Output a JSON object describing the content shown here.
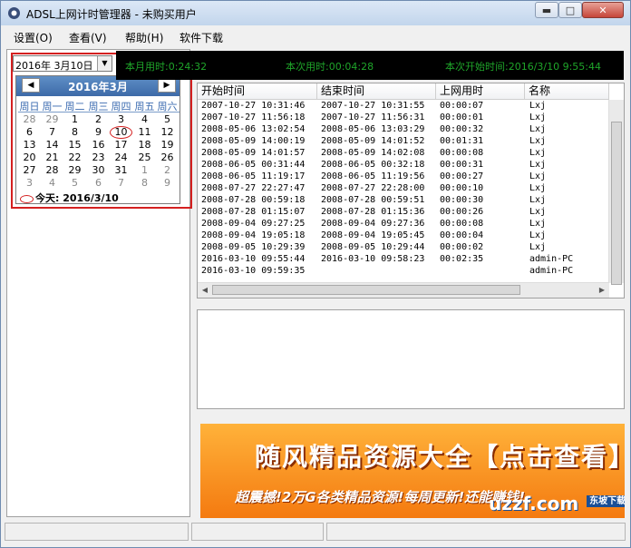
{
  "window": {
    "title": "ADSL上网计时管理器 - 未购买用户",
    "min_symbol": "▬",
    "max_symbol": "□",
    "close_symbol": "✕"
  },
  "menu": {
    "items": [
      "设置(O)",
      "查看(V)",
      "帮助(H)",
      "软件下载"
    ]
  },
  "date_picker": {
    "value": "2016年  3月10日"
  },
  "calendar": {
    "month_title": "2016年3月",
    "weekdays": [
      "周日",
      "周一",
      "周二",
      "周三",
      "周四",
      "周五",
      "周六"
    ],
    "days": [
      [
        "28",
        "29",
        "1",
        "2",
        "3",
        "4",
        "5"
      ],
      [
        "6",
        "7",
        "8",
        "9",
        "10",
        "11",
        "12"
      ],
      [
        "13",
        "14",
        "15",
        "16",
        "17",
        "18",
        "19"
      ],
      [
        "20",
        "21",
        "22",
        "23",
        "24",
        "25",
        "26"
      ],
      [
        "27",
        "28",
        "29",
        "30",
        "31",
        "1",
        "2"
      ],
      [
        "3",
        "4",
        "5",
        "6",
        "7",
        "8",
        "9"
      ]
    ],
    "selected_day": "10",
    "today_text": "今天: 2016/3/10"
  },
  "status": {
    "month_usage": "本月用时:0:24:32",
    "current_usage": "本次用时:00:04:28",
    "current_start": "本次开始时间:2016/3/10 9:55:44"
  },
  "table": {
    "headers": [
      "开始时间",
      "结束时间",
      "上网用时",
      "名称"
    ],
    "rows": [
      [
        "2007-10-27 10:31:46",
        "2007-10-27 10:31:55",
        "00:00:07",
        "Lxj"
      ],
      [
        "2007-10-27 11:56:18",
        "2007-10-27 11:56:31",
        "00:00:01",
        "Lxj"
      ],
      [
        "2008-05-06 13:02:54",
        "2008-05-06 13:03:29",
        "00:00:32",
        "Lxj"
      ],
      [
        "2008-05-09 14:00:19",
        "2008-05-09 14:01:52",
        "00:01:31",
        "Lxj"
      ],
      [
        "2008-05-09 14:01:57",
        "2008-05-09 14:02:08",
        "00:00:08",
        "Lxj"
      ],
      [
        "2008-06-05 00:31:44",
        "2008-06-05 00:32:18",
        "00:00:31",
        "Lxj"
      ],
      [
        "2008-06-05 11:19:17",
        "2008-06-05 11:19:56",
        "00:00:27",
        "Lxj"
      ],
      [
        "2008-07-27 22:27:47",
        "2008-07-27 22:28:00",
        "00:00:10",
        "Lxj"
      ],
      [
        "2008-07-28 00:59:18",
        "2008-07-28 00:59:51",
        "00:00:30",
        "Lxj"
      ],
      [
        "2008-07-28 01:15:07",
        "2008-07-28 01:15:36",
        "00:00:26",
        "Lxj"
      ],
      [
        "2008-09-04 09:27:25",
        "2008-09-04 09:27:36",
        "00:00:08",
        "Lxj"
      ],
      [
        "2008-09-04 19:05:18",
        "2008-09-04 19:05:45",
        "00:00:04",
        "Lxj"
      ],
      [
        "2008-09-05 10:29:39",
        "2008-09-05 10:29:44",
        "00:00:02",
        "Lxj"
      ],
      [
        "2016-03-10 09:55:44",
        "2016-03-10 09:58:23",
        "00:02:35",
        "admin-PC"
      ],
      [
        "2016-03-10 09:59:35",
        "",
        "",
        "admin-PC"
      ]
    ]
  },
  "ad": {
    "headline": "随风精品资源大全【点击查看】",
    "subline": "超震撼!2万G各类精品资源!每周更新!还能赚钱!",
    "logo_text": "uzzf.com",
    "logo_tag": "东坡下载"
  }
}
